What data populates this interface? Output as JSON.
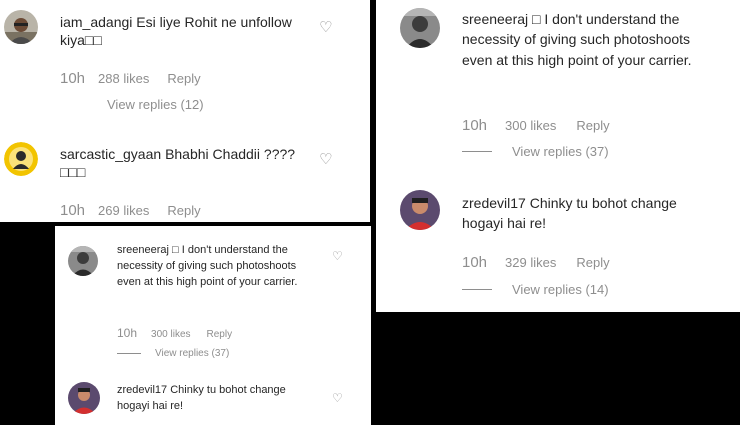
{
  "panel_a": {
    "comments": [
      {
        "username": "iam_adangi",
        "text": "Esi liye Rohit ne unfollow kiya□□",
        "time": "10h",
        "likes": "288 likes",
        "reply": "Reply",
        "view_replies": "View replies (12)"
      },
      {
        "username": "sarcastic_gyaan",
        "text": "Bhabhi Chaddii ???? □□□",
        "time": "10h",
        "likes": "269 likes",
        "reply": "Reply"
      }
    ]
  },
  "panel_b": {
    "comments": [
      {
        "username": "sreeneeraj",
        "text": "□ I don't understand the necessity of giving such photoshoots even at this high point of your carrier.",
        "time": "10h",
        "likes": "300 likes",
        "reply": "Reply",
        "view_replies": "View replies (37)"
      },
      {
        "username": "zredevil17",
        "text": "Chinky tu bohot change hogayi hai re!",
        "time": "10h",
        "likes": "329 likes",
        "reply": "Reply",
        "view_replies": "View replies (14)"
      }
    ]
  },
  "panel_c": {
    "comments": [
      {
        "username": "sreeneeraj",
        "text": "□ I don't understand the necessity of giving such photoshoots even at this high point of your carrier.",
        "time": "10h",
        "likes": "300 likes",
        "reply": "Reply",
        "view_replies": "View replies (37)"
      },
      {
        "username": "zredevil17",
        "text": "Chinky tu bohot change hogayi hai re!"
      }
    ]
  },
  "icons": {
    "like": "heart-outline-icon"
  },
  "colors": {
    "text": "#262626",
    "secondary": "#8e8e8e",
    "background": "#000000"
  }
}
